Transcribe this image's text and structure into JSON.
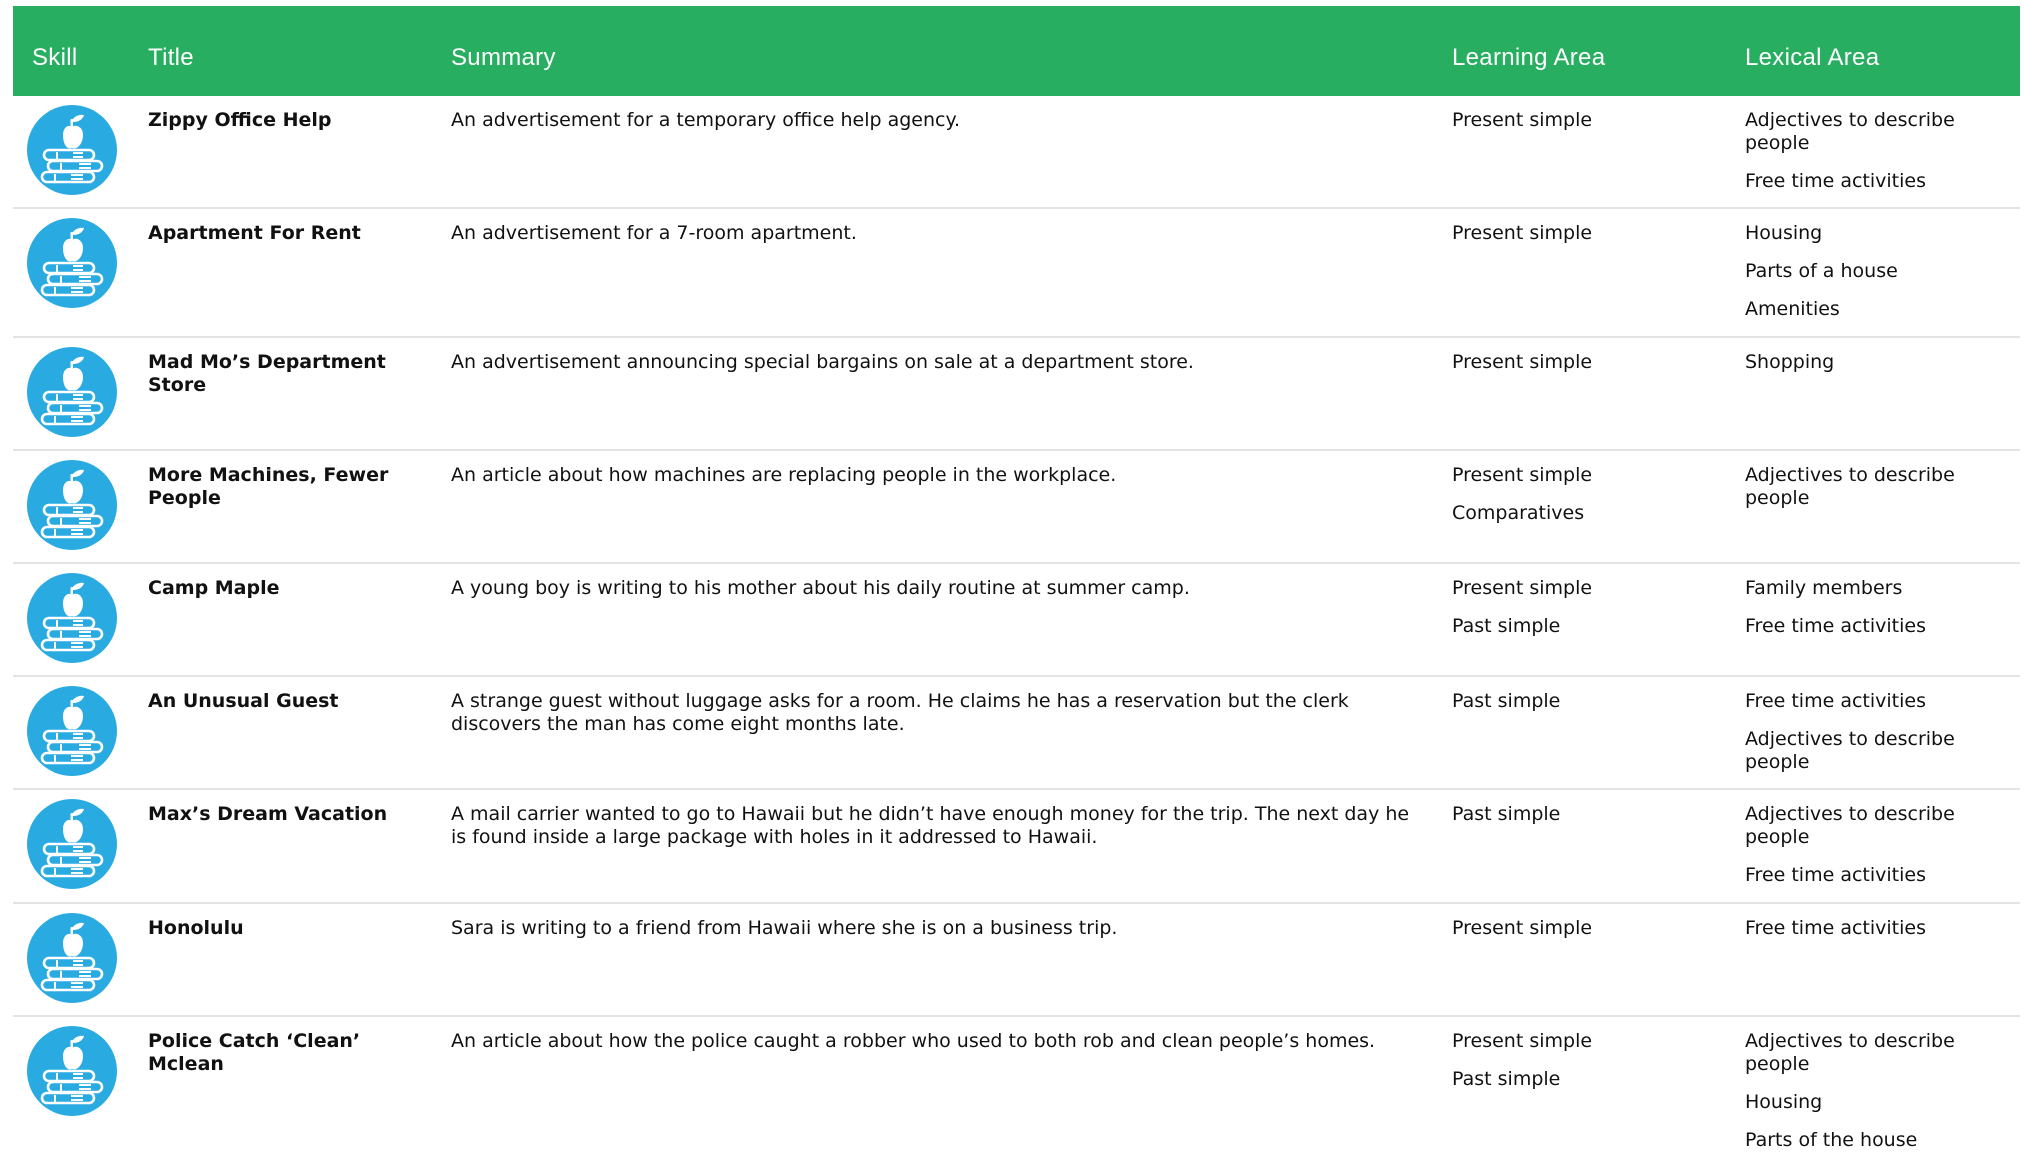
{
  "colors": {
    "header_bg": "#27ae60",
    "header_text": "#ffffff",
    "icon_bg": "#29abe2",
    "row_border": "#e3e3e3"
  },
  "headers": {
    "skill": "Skill",
    "title": "Title",
    "summary": "Summary",
    "learning": "Learning Area",
    "lexical": "Lexical Area"
  },
  "skill_icon": "books-with-apple-icon",
  "rows": [
    {
      "title": "Zippy Office Help",
      "summary": "An advertisement for a temporary office help agency.",
      "learning": [
        "Present simple"
      ],
      "lexical": [
        "Adjectives to describe people",
        "Free time activities"
      ]
    },
    {
      "title": "Apartment For Rent",
      "summary": "An advertisement for a 7-room apartment.",
      "learning": [
        "Present simple"
      ],
      "lexical": [
        "Housing",
        "Parts of a house",
        "Amenities"
      ]
    },
    {
      "title": "Mad Mo’s Department Store",
      "summary": "An advertisement announcing special bargains on sale at a department store.",
      "learning": [
        "Present simple"
      ],
      "lexical": [
        "Shopping"
      ]
    },
    {
      "title": "More Machines, Fewer People",
      "summary": "An article about how machines are replacing people in the workplace.",
      "learning": [
        "Present simple",
        "Comparatives"
      ],
      "lexical": [
        "Adjectives to describe people"
      ]
    },
    {
      "title": "Camp Maple",
      "summary": "A young boy is writing to his mother about his daily routine at summer camp.",
      "learning": [
        "Present simple",
        "Past simple"
      ],
      "lexical": [
        "Family members",
        "Free time activities"
      ]
    },
    {
      "title": "An Unusual Guest",
      "summary": "A strange guest without luggage asks for a room. He claims he has a reservation but the clerk discovers the man has come eight months late.",
      "learning": [
        "Past simple"
      ],
      "lexical": [
        "Free time activities",
        "Adjectives to describe people"
      ]
    },
    {
      "title": "Max’s Dream Vacation",
      "summary": "A mail carrier wanted to go to Hawaii but he didn’t have enough money for the trip. The next day he is found inside a large package with holes in it addressed to Hawaii.",
      "learning": [
        "Past simple"
      ],
      "lexical": [
        "Adjectives to describe people",
        "Free time activities"
      ]
    },
    {
      "title": "Honolulu",
      "summary": "Sara is writing to a friend from Hawaii where she is on a business trip.",
      "learning": [
        "Present simple"
      ],
      "lexical": [
        "Free time activities"
      ]
    },
    {
      "title": "Police Catch ‘Clean’ Mclean",
      "summary": "An article about how the police caught a robber who used to both rob and clean people’s homes.",
      "learning": [
        "Present simple",
        "Past simple"
      ],
      "lexical": [
        "Adjectives to describe people",
        "Housing",
        "Parts of the house"
      ]
    }
  ]
}
